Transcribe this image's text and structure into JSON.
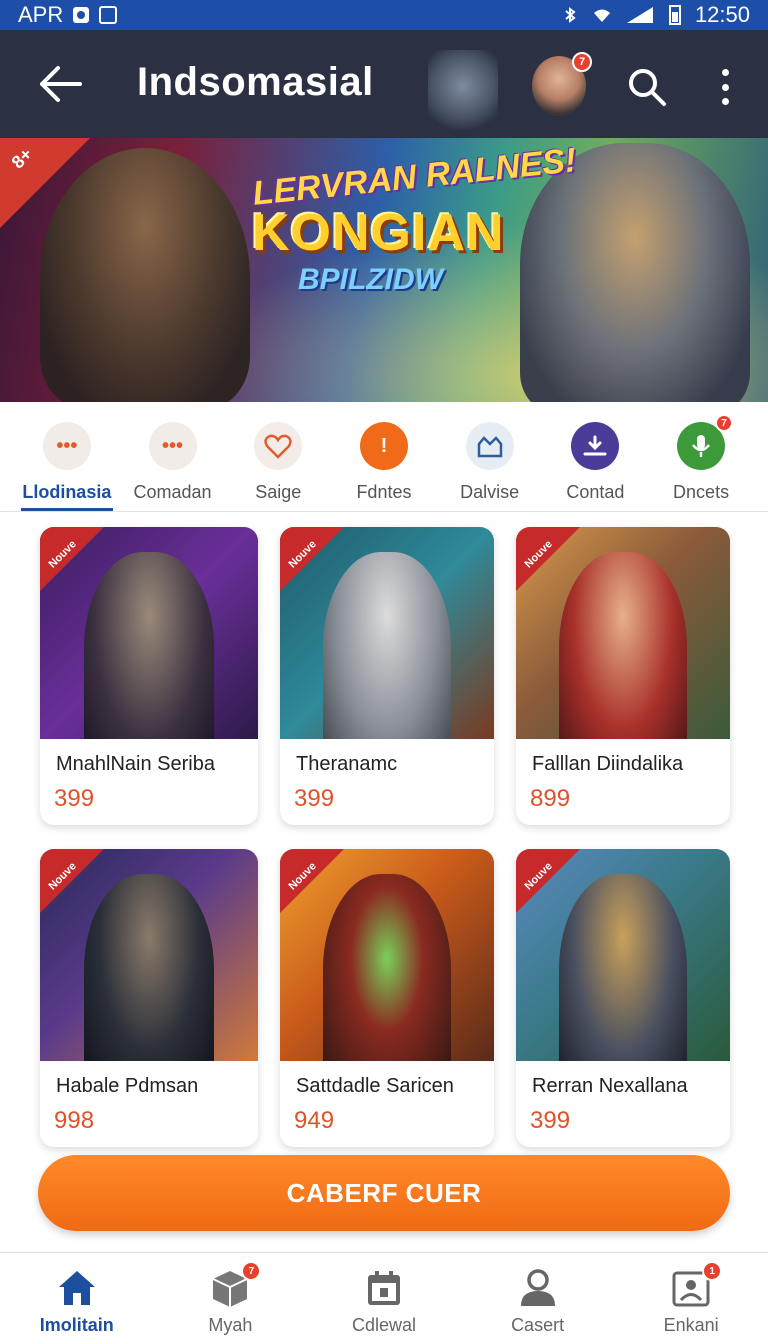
{
  "status_bar": {
    "left_text": "APR",
    "time": "12:50"
  },
  "app_bar": {
    "title": "Indsomasial",
    "notification_count": "7"
  },
  "banner": {
    "corner_label": "8+",
    "line1": "LERVRAN RALNES!",
    "line2": "KONGIAN",
    "line3": "BPILZIDW"
  },
  "categories": [
    {
      "label": "Llodinasia",
      "icon": "dots-icon",
      "active": true
    },
    {
      "label": "Comadan",
      "icon": "dots-icon"
    },
    {
      "label": "Saige",
      "icon": "heart-icon"
    },
    {
      "label": "Fdntes",
      "icon": "info-icon"
    },
    {
      "label": "Dalvise",
      "icon": "castle-icon"
    },
    {
      "label": "Contad",
      "icon": "download-icon"
    },
    {
      "label": "Dncets",
      "icon": "microphone-icon",
      "badge": "7"
    }
  ],
  "products": [
    {
      "ribbon": "Nouve",
      "title": "MnahlNain Seriba",
      "price": "399"
    },
    {
      "ribbon": "Nouve",
      "title": "Theranamc",
      "price": "399"
    },
    {
      "ribbon": "Nouve",
      "title": "Falllan Diindalika",
      "price": "899"
    },
    {
      "ribbon": "Nouve",
      "title": "Habale Pdmsan",
      "price": "998"
    },
    {
      "ribbon": "Nouve",
      "title": "Sattdadle Saricen",
      "price": "949"
    },
    {
      "ribbon": "Nouve",
      "title": "Rerran Nexallana",
      "price": "399"
    }
  ],
  "cta": {
    "label": "CABERF CUER"
  },
  "bottom_nav": [
    {
      "label": "Imolitain",
      "icon": "home-icon",
      "active": true
    },
    {
      "label": "Myah",
      "icon": "box-icon",
      "badge": "7"
    },
    {
      "label": "Cdlewal",
      "icon": "calendar-icon"
    },
    {
      "label": "Casert",
      "icon": "user-icon"
    },
    {
      "label": "Enkani",
      "icon": "profile-card-icon",
      "badge": "1"
    }
  ],
  "colors": {
    "primary": "#1d4f9e",
    "accent": "#f06a12",
    "appbar": "#2b3142",
    "price": "#e0522a",
    "badge": "#e8402f"
  }
}
